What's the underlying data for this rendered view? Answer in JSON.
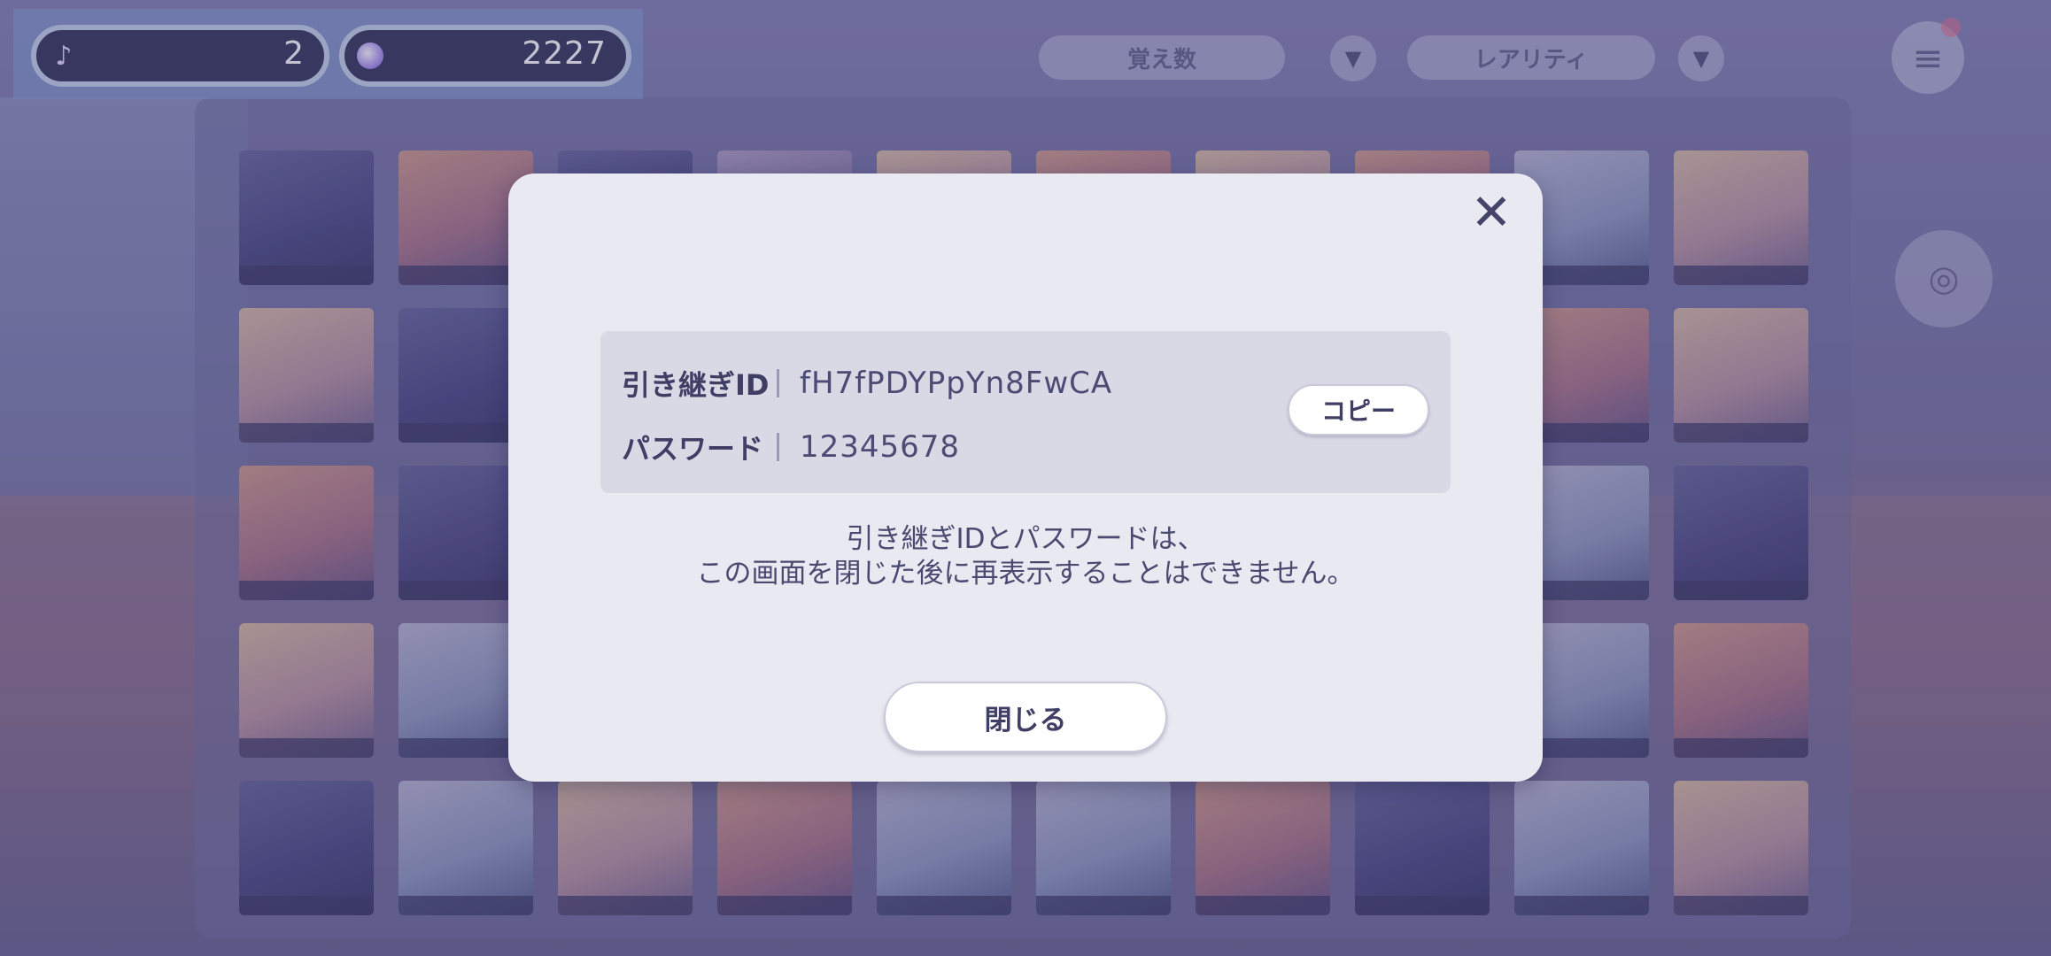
{
  "hud": {
    "note_count": "2",
    "note_icon": "music-note-icon",
    "gem_count": "2227",
    "gem_icon": "crystal-gem-icon"
  },
  "toolbar": {
    "sort_label": "覚え数",
    "rarity_label": "レアリティ"
  },
  "dialog": {
    "transfer_id_label": "引き継ぎID",
    "transfer_id_value": "fH7fPDYPpYn8FwCA",
    "password_label": "パスワード",
    "password_value": "12345678",
    "copy_label": "コピー",
    "notice_line1": "引き継ぎIDとパスワードは、",
    "notice_line2": "この画面を閉じた後に再表示することはできません。",
    "close_label": "閉じる",
    "close_icon": "close-icon"
  },
  "colors": {
    "modal_bg": "#e9e9f1",
    "info_box_bg": "#d9d9e6",
    "text_primary": "#3f3e64",
    "button_bg": "#ffffff"
  }
}
